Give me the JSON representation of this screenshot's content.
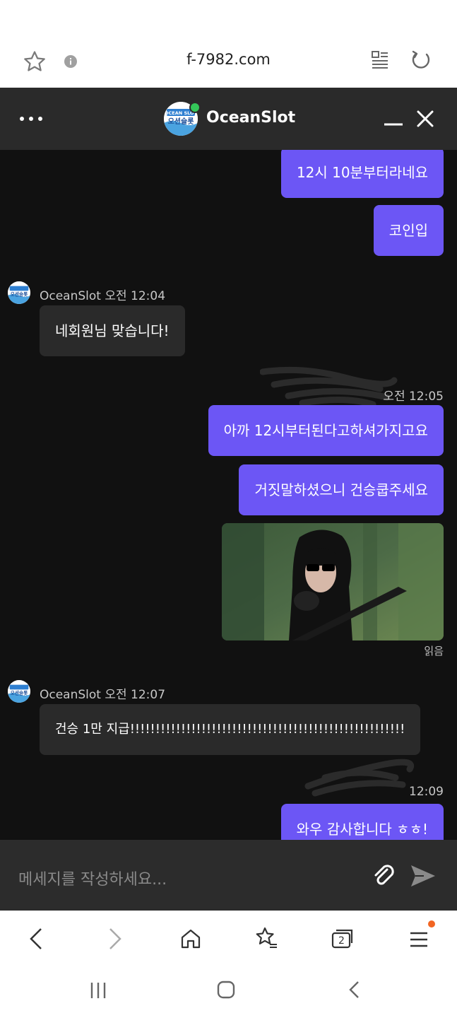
{
  "browser": {
    "url": "f-7982.com",
    "tab_count": "2"
  },
  "header": {
    "title": "OceanSlot",
    "logo_text_top": "OCEAN SLOT",
    "logo_text_bottom": "오션슬롯"
  },
  "messages": {
    "m1": "12시 10분부터라네요",
    "m2": "코인입",
    "g1_sender": "OceanSlot 오전 12:04",
    "m3": "네회원님 맞습니다!",
    "t2": "오전 12:05",
    "m4": "아까 12시부터된다고하셔가지고요",
    "m5": "거짓말하셨으니 건승쿱주세요",
    "read_label": "읽음",
    "g3_sender": "OceanSlot 오전 12:07",
    "m6": "건승 1만 지급!!!!!!!!!!!!!!!!!!!!!!!!!!!!!!!!!!!!!!!!!!!!!!!!!!!!!!",
    "t3": "12:09",
    "m7": "와우 감사합니다 ㅎㅎ!"
  },
  "composer": {
    "placeholder": "메세지를 작성하세요..."
  },
  "colors": {
    "accent": "#6c56f5",
    "header_bg": "#2a2a2a",
    "chat_bg": "#111111",
    "online": "#34c759"
  },
  "icons": [
    "star-icon",
    "info-icon",
    "reader-mode-icon",
    "reload-icon",
    "more-icon",
    "minimize-icon",
    "close-icon",
    "attach-icon",
    "send-icon",
    "back-icon",
    "forward-icon",
    "home-icon",
    "bookmarks-icon",
    "tabs-icon",
    "menu-icon",
    "recents-icon",
    "home-button-icon",
    "system-back-icon"
  ]
}
